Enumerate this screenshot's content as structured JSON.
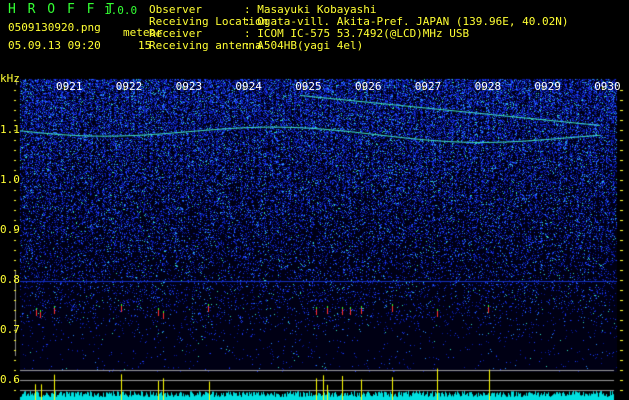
{
  "app": {
    "title": "H R O F F T",
    "version": "1.0.0"
  },
  "file": {
    "name": "0509130920.png",
    "datetime": "05.09.13 09:20"
  },
  "meteor": {
    "label": "meteor",
    "count": "15"
  },
  "info": [
    {
      "label": "Observer",
      "value": ": Masayuki Kobayashi"
    },
    {
      "label": "Receiving Location",
      "value": ": Ogata-vill. Akita-Pref. JAPAN (139.96E, 40.02N)"
    },
    {
      "label": "Receiver",
      "value": ": ICOM IC-575 53.7492(@LCD)MHz USB"
    },
    {
      "label": "Receiving antenna",
      "value": ": A504HB(yagi 4el)"
    }
  ],
  "axis": {
    "unit": "kHz",
    "y_ticks": [
      "1.1",
      "1.0",
      "0.9",
      "0.8",
      "0.7",
      "0.6"
    ],
    "time_ticks": [
      "0921",
      "0922",
      "0923",
      "0924",
      "0925",
      "0926",
      "0927",
      "0928",
      "0929",
      "0930"
    ]
  },
  "colors": {
    "label": "#ffff33",
    "title": "#33ff33",
    "histogram": "#00e5e5",
    "meteor_bar": "#ffff00"
  }
}
